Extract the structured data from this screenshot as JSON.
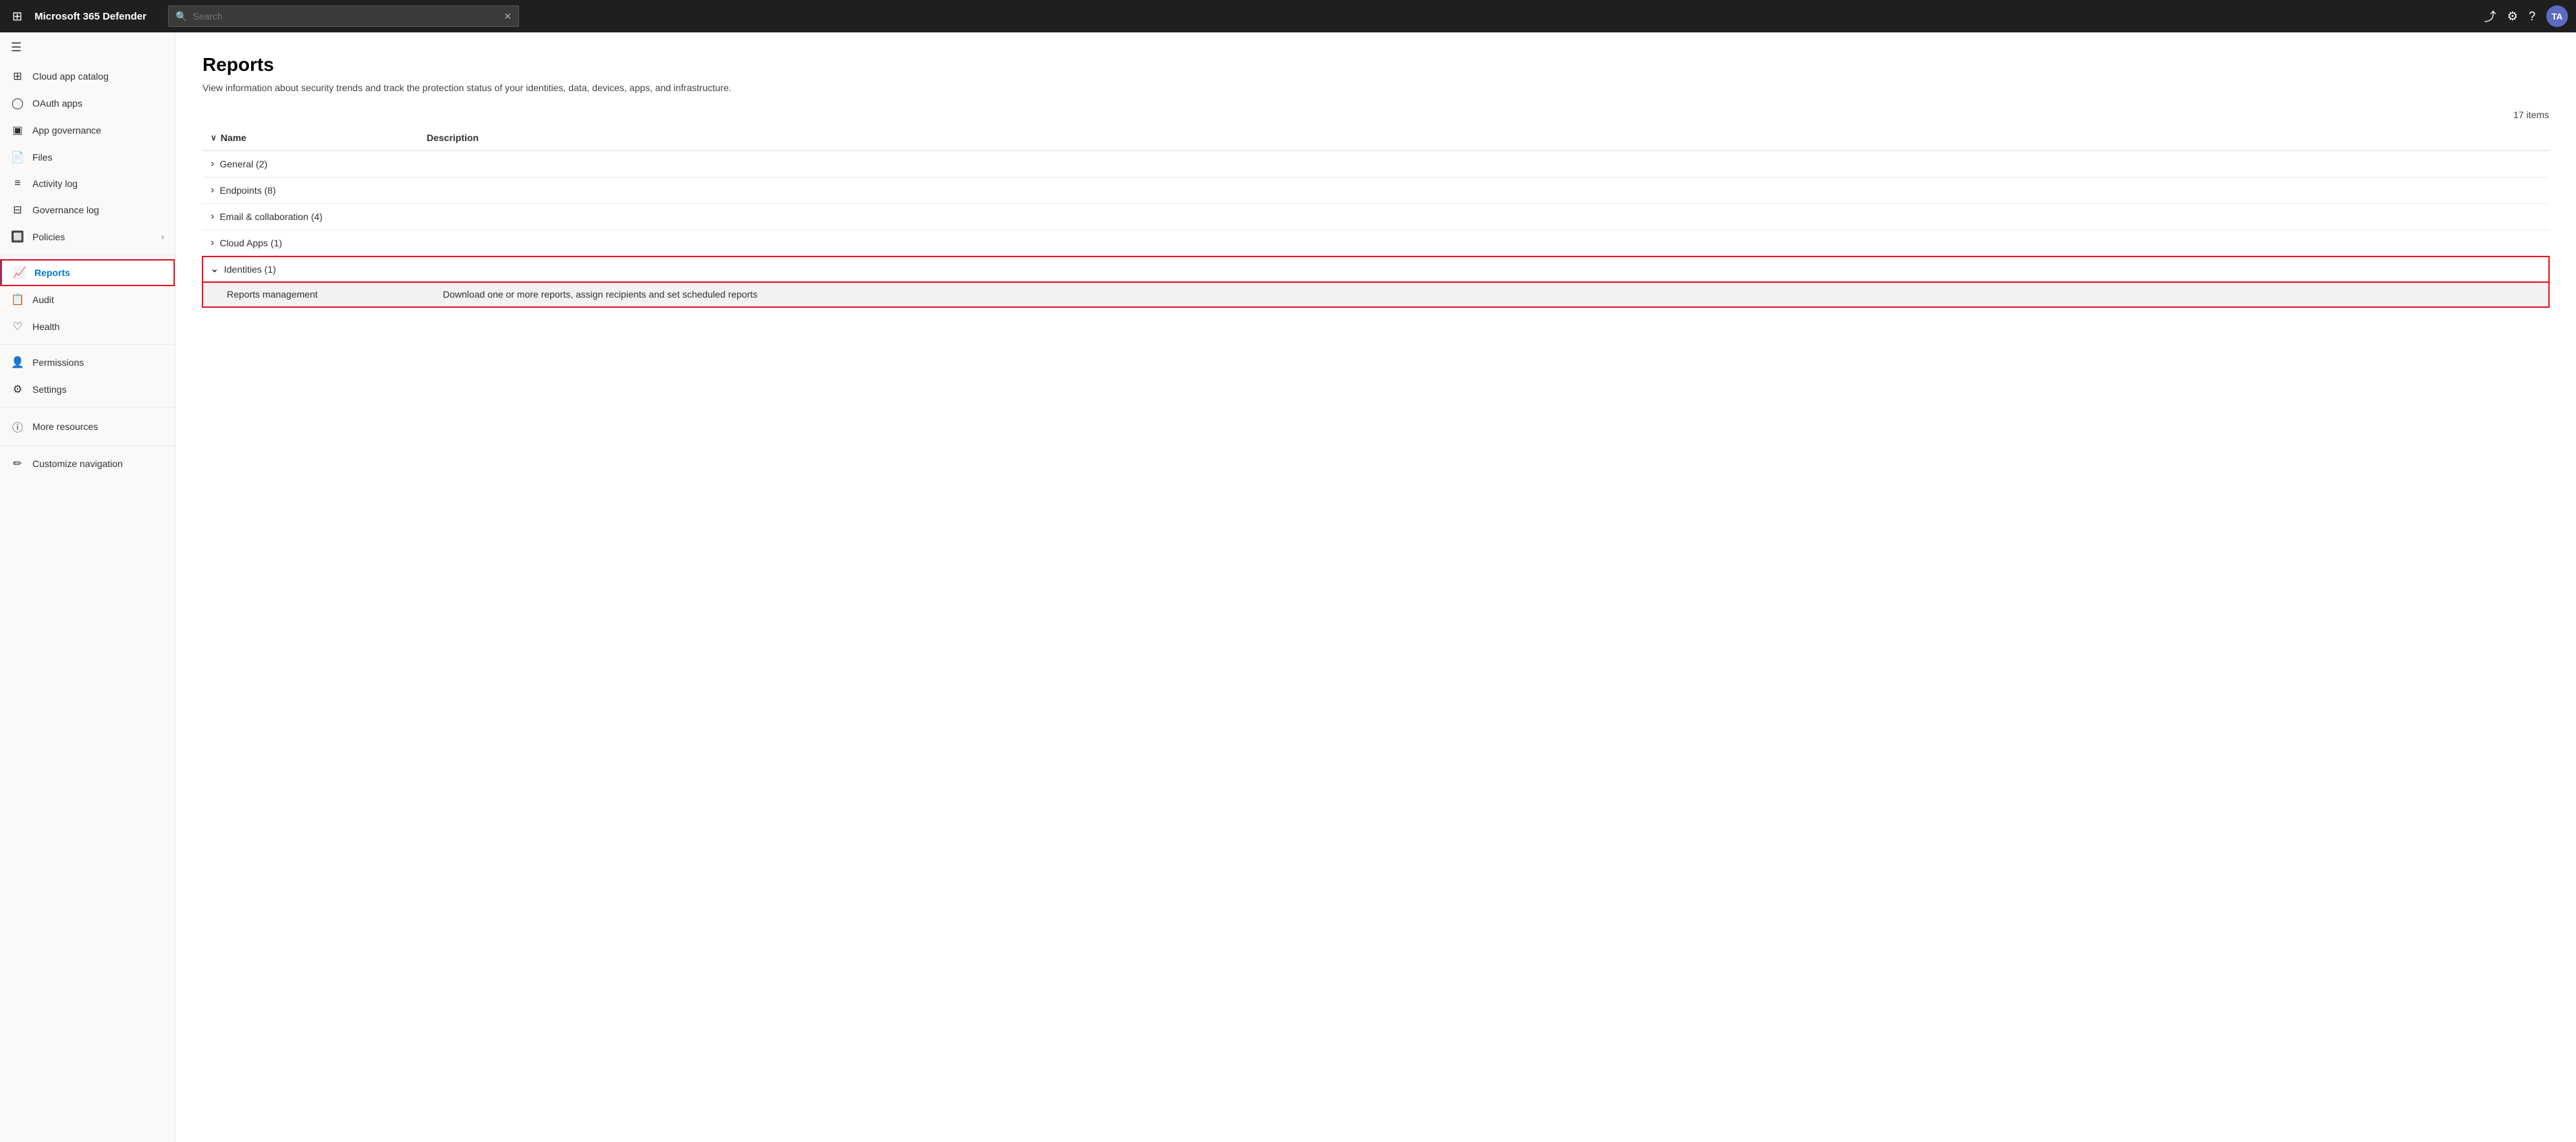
{
  "app": {
    "title": "Microsoft 365 Defender"
  },
  "topbar": {
    "title": "Microsoft 365 Defender",
    "search_placeholder": "Search",
    "avatar_initials": "TA"
  },
  "sidebar": {
    "toggle_label": "Toggle navigation",
    "items": [
      {
        "id": "cloud-app-catalog",
        "label": "Cloud app catalog",
        "icon": "⊞"
      },
      {
        "id": "oauth-apps",
        "label": "OAuth apps",
        "icon": "○"
      },
      {
        "id": "app-governance",
        "label": "App governance",
        "icon": "◻"
      },
      {
        "id": "files",
        "label": "Files",
        "icon": "📄"
      },
      {
        "id": "activity-log",
        "label": "Activity log",
        "icon": "≡"
      },
      {
        "id": "governance-log",
        "label": "Governance log",
        "icon": "⊟"
      },
      {
        "id": "policies",
        "label": "Policies",
        "icon": "🔲",
        "has_chevron": true
      },
      {
        "id": "reports",
        "label": "Reports",
        "icon": "📈",
        "active": true,
        "highlighted": true
      },
      {
        "id": "audit",
        "label": "Audit",
        "icon": "📋"
      },
      {
        "id": "health",
        "label": "Health",
        "icon": "❤"
      },
      {
        "id": "permissions",
        "label": "Permissions",
        "icon": "👤"
      },
      {
        "id": "settings",
        "label": "Settings",
        "icon": "⚙"
      },
      {
        "id": "more-resources",
        "label": "More resources",
        "icon": "ⓘ"
      },
      {
        "id": "customize-navigation",
        "label": "Customize navigation",
        "icon": "✏"
      }
    ]
  },
  "main": {
    "title": "Reports",
    "subtitle": "View information about security trends and track the protection status of your identities, data, devices, apps, and infrastructure.",
    "items_count": "17 items",
    "columns": {
      "name": "Name",
      "description": "Description"
    },
    "groups": [
      {
        "id": "general",
        "label": "General (2)",
        "expanded": false,
        "highlighted": false,
        "children": []
      },
      {
        "id": "endpoints",
        "label": "Endpoints (8)",
        "expanded": false,
        "highlighted": false,
        "children": []
      },
      {
        "id": "email-collaboration",
        "label": "Email & collaboration (4)",
        "expanded": false,
        "highlighted": false,
        "children": []
      },
      {
        "id": "cloud-apps",
        "label": "Cloud Apps (1)",
        "expanded": false,
        "highlighted": false,
        "children": []
      },
      {
        "id": "identities",
        "label": "Identities (1)",
        "expanded": true,
        "highlighted": true,
        "children": [
          {
            "id": "reports-management",
            "label": "Reports management",
            "description": "Download one or more reports, assign recipients and set scheduled reports"
          }
        ]
      }
    ]
  }
}
